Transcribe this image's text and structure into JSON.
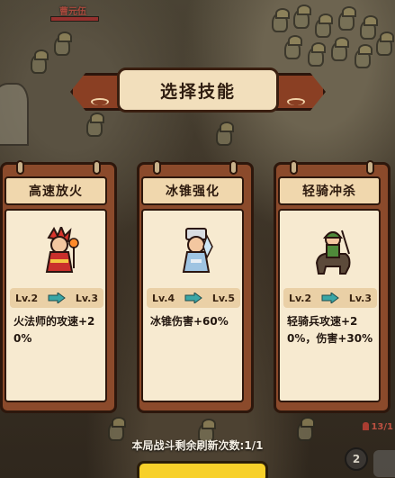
{
  "topUnit": {
    "name": "曹元伍",
    "sub": "x7"
  },
  "dialog": {
    "title": "选择技能"
  },
  "cards": [
    {
      "name": "高速放火",
      "from": "Lv.2",
      "to": "Lv.3",
      "desc": "火法师的攻速+20%",
      "hero": "fire-mage-icon",
      "color": "#c9302c"
    },
    {
      "name": "冰锥强化",
      "from": "Lv.4",
      "to": "Lv.5",
      "desc": "冰锥伤害+60%",
      "hero": "ice-mage-icon",
      "color": "#8fb6d8"
    },
    {
      "name": "轻骑冲杀",
      "from": "Lv.2",
      "to": "Lv.3",
      "desc": "轻骑兵攻速+20%，伤害+30%",
      "hero": "light-cavalry-icon",
      "color": "#4f8a3a"
    }
  ],
  "footer": {
    "refresh": "本局战斗剩余刷新次数:1/1",
    "counter": "13/1",
    "badge": "2"
  },
  "colors": {
    "accent": "#3aa6a6",
    "panel": "#8b4a2b",
    "paper": "#f7ead0"
  }
}
